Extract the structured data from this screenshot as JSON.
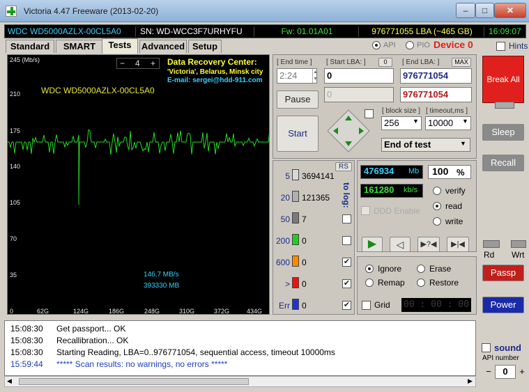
{
  "window": {
    "title": "Victoria 4.47  Freeware (2013-02-20)",
    "controls": {
      "minimize": "–",
      "maximize": "□",
      "close": "✕"
    }
  },
  "infobar": {
    "model": "WDC WD5000AZLX-00CL5A0",
    "serial": "SN: WD-WCC3F7URHYFU",
    "firmware": "Fw: 01.01A01",
    "capacity": "976771055 LBA (~465 GB)",
    "time": "16:09:07"
  },
  "tabs": [
    {
      "label": "Standard"
    },
    {
      "label": "SMART"
    },
    {
      "label": "Tests"
    },
    {
      "label": "Advanced"
    },
    {
      "label": "Setup"
    }
  ],
  "mode": {
    "api": "API",
    "pio": "PIO",
    "device": "Device 0",
    "hints": "Hints"
  },
  "graph": {
    "ylabel": "245 (Mb/s)",
    "yticks": [
      "210",
      "175",
      "140",
      "105",
      "70",
      "35"
    ],
    "xticks": [
      "0",
      "62G",
      "124G",
      "186G",
      "248G",
      "310G",
      "372G",
      "434G"
    ],
    "drive_label": "WDC WD5000AZLX-00CL5A0",
    "zoom": "4",
    "zoom_minus": "−",
    "zoom_plus": "+",
    "speed": "146,7 MB/s",
    "position": "393330 MB",
    "recovery": {
      "title": "Data Recovery Center:",
      "line1": "'Victoria', Belarus, Minsk city",
      "line2": "E-mail: sergei@hdd-911.com"
    }
  },
  "controls": {
    "end_time_label": "[ End time ]",
    "end_time": "2:24",
    "start_lba_label": "[ Start LBA: ]",
    "start_lba_btn": "0",
    "start_lba": "0",
    "start_lba2": "0",
    "end_lba_label": "[ End LBA: ]",
    "end_lba_btn": "MAX",
    "end_lba": "976771054",
    "end_lba2": "976771054",
    "pause": "Pause",
    "start": "Start",
    "block_size_label": "[ block size ]",
    "block_size": "256",
    "timeout_label": "[ timeout,ms ]",
    "timeout": "10000",
    "end_action": "End of test"
  },
  "stats": {
    "rs": "RS",
    "to_log": "to log:",
    "rows": [
      {
        "label": "5",
        "count": "3694141",
        "color": "#d8d8d8"
      },
      {
        "label": "20",
        "count": "121365",
        "color": "#b0b0b0"
      },
      {
        "label": "50",
        "count": "7",
        "color": "#7a7a7a"
      },
      {
        "label": "200",
        "count": "0",
        "color": "#22cc22"
      },
      {
        "label": "600",
        "count": "0",
        "color": "#ff8800"
      },
      {
        "label": ">",
        "count": "0",
        "color": "#ee1111"
      },
      {
        "label": "Err",
        "count": "0",
        "color": "#2233cc"
      }
    ]
  },
  "progress": {
    "mb": "476934",
    "mb_unit": "Mb",
    "percent": "100",
    "percent_unit": "%",
    "speed": "161280",
    "speed_unit": "kb/s",
    "ddd": "DDD Enable",
    "verify": "verify",
    "read": "read",
    "write": "write"
  },
  "actions": {
    "ignore": "Ignore",
    "erase": "Erase",
    "remap": "Remap",
    "restore": "Restore",
    "grid": "Grid",
    "timer": "00 : 00 : 00"
  },
  "side": {
    "break_all": "Break All",
    "sleep": "Sleep",
    "recall": "Recall",
    "rd": "Rd",
    "wrt": "Wrt",
    "passp": "Passp",
    "power": "Power",
    "sound": "sound",
    "api_number_label": "API number",
    "api_number": "0",
    "spin_minus": "−",
    "spin_plus": "+"
  },
  "log": [
    {
      "time": "15:08:30",
      "msg": "Get passport... OK",
      "color": "#000000"
    },
    {
      "time": "15:08:30",
      "msg": "Recallibration... OK",
      "color": "#000000"
    },
    {
      "time": "15:08:30",
      "msg": "Starting Reading, LBA=0..976771054, sequential access, timeout 10000ms",
      "color": "#000000"
    },
    {
      "time": "15:59:44",
      "msg": "***** Scan results: no warnings, no errors *****",
      "color": "#1a3cc8"
    }
  ],
  "colors": {
    "accent_red": "#e0201c",
    "graph_line": "#22dd22",
    "info_cyan": "#32d2ff"
  }
}
